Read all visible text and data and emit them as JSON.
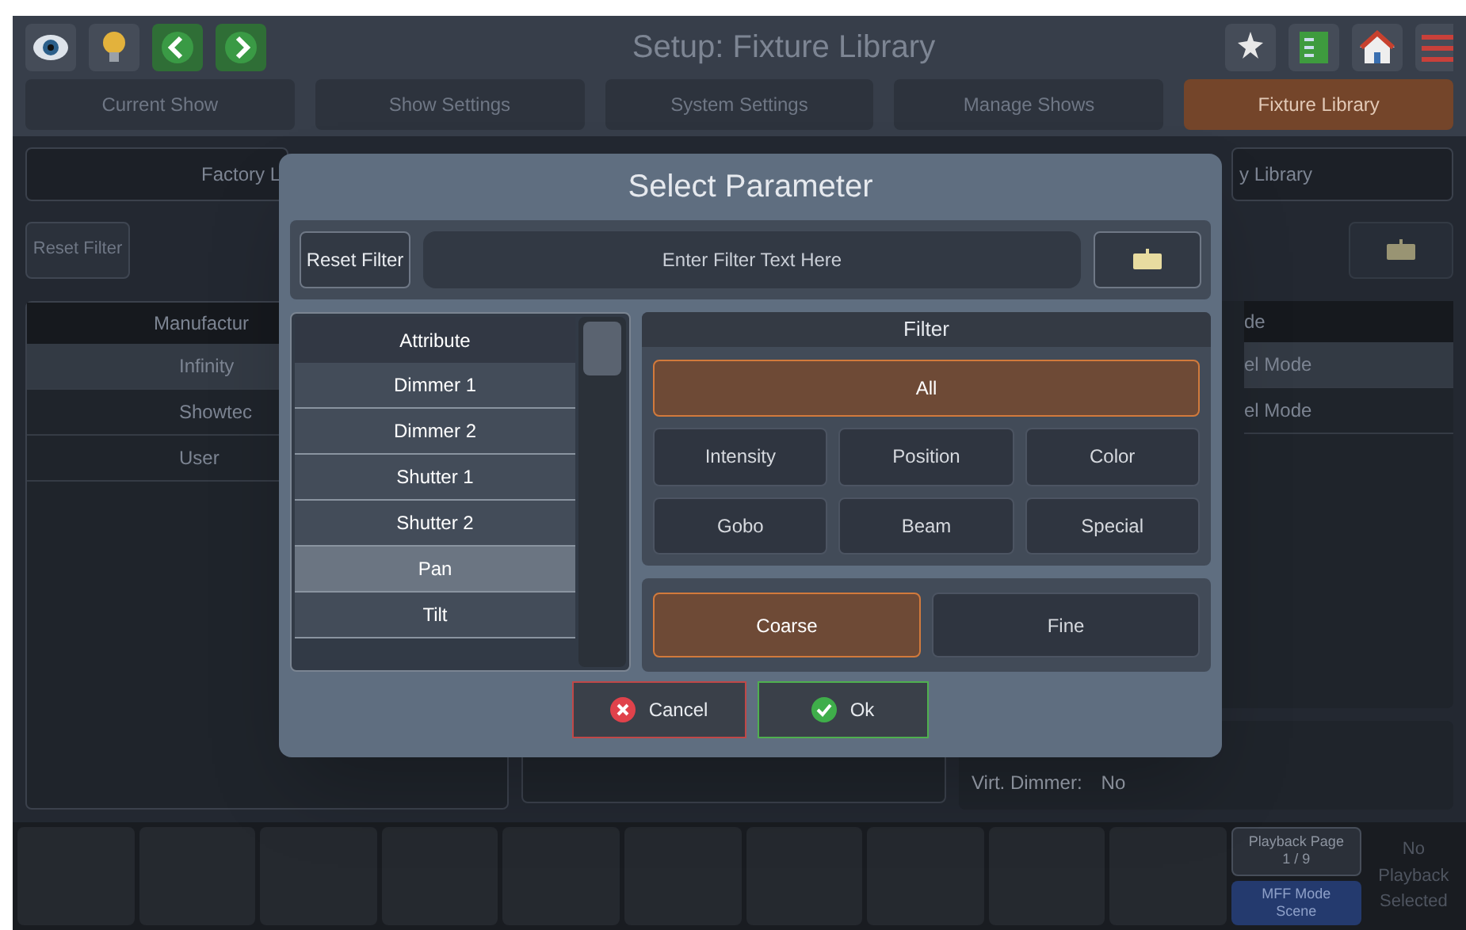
{
  "header": {
    "title": "Setup: Fixture Library"
  },
  "tabs": [
    {
      "label": "Current Show",
      "selected": false
    },
    {
      "label": "Show Settings",
      "selected": false
    },
    {
      "label": "System Settings",
      "selected": false
    },
    {
      "label": "Manage Shows",
      "selected": false
    },
    {
      "label": "Fixture Library",
      "selected": true
    }
  ],
  "library_tabs": [
    "Factory L",
    "y Library"
  ],
  "filter_bar": {
    "reset": "Reset Filter"
  },
  "manufacturers": {
    "heading": "Manufactur",
    "items": [
      {
        "label": "Infinity",
        "selected": true
      },
      {
        "label": "Showtec",
        "selected": false
      },
      {
        "label": "User",
        "selected": false
      }
    ]
  },
  "modes": {
    "heading": "de",
    "items": [
      {
        "label": "el Mode",
        "selected": true
      },
      {
        "label": "el Mode",
        "selected": false
      }
    ]
  },
  "details": [
    "Virt. Dimmer:",
    "No"
  ],
  "playback": {
    "page_label": "Playback Page",
    "page": "1 / 9",
    "mff_label": "MFF Mode",
    "mff_value": "Scene",
    "status": "No Playback Selected"
  },
  "dialog": {
    "title": "Select Parameter",
    "reset": "Reset Filter",
    "placeholder": "Enter Filter Text Here",
    "list_heading": "Attribute",
    "parameters": [
      {
        "label": "Dimmer 1",
        "selected": false
      },
      {
        "label": "Dimmer 2",
        "selected": false
      },
      {
        "label": "Shutter 1",
        "selected": false
      },
      {
        "label": "Shutter 2",
        "selected": false
      },
      {
        "label": "Pan",
        "selected": true
      },
      {
        "label": "Tilt",
        "selected": false
      }
    ],
    "filter_heading": "Filter",
    "filters": [
      {
        "label": "All",
        "selected": true
      },
      {
        "label": "Intensity",
        "selected": false
      },
      {
        "label": "Position",
        "selected": false
      },
      {
        "label": "Color",
        "selected": false
      },
      {
        "label": "Gobo",
        "selected": false
      },
      {
        "label": "Beam",
        "selected": false
      },
      {
        "label": "Special",
        "selected": false
      }
    ],
    "resolutions": [
      {
        "label": "Coarse",
        "selected": true
      },
      {
        "label": "Fine",
        "selected": false
      }
    ],
    "cancel": "Cancel",
    "ok": "Ok"
  }
}
